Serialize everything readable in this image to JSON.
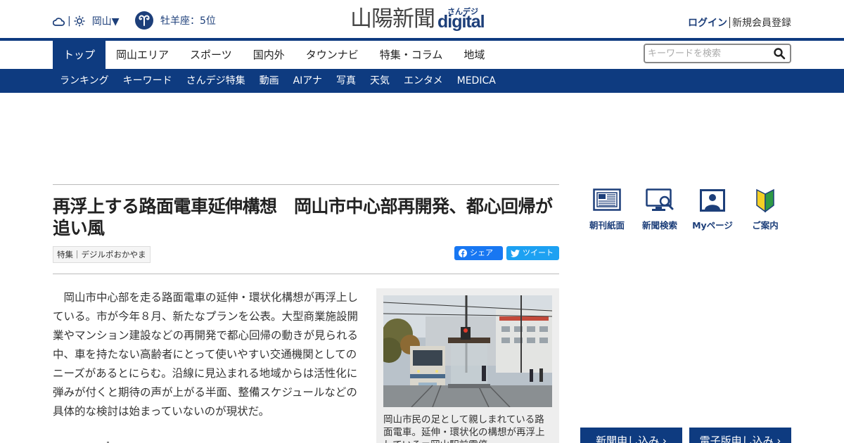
{
  "header": {
    "weather": {
      "region": "岡山▼"
    },
    "horoscope": {
      "text": "牡羊座：5位"
    },
    "logo": {
      "kanji": "山陽新聞",
      "small": "さんデジ",
      "digital": "digital"
    },
    "auth": {
      "login": "ログイン",
      "register": "新規会員登録"
    }
  },
  "nav": {
    "main": [
      "トップ",
      "岡山エリア",
      "スポーツ",
      "国内外",
      "タウンナビ",
      "特集・コラム",
      "地域"
    ],
    "active_index": 0,
    "search_placeholder": "キーワードを検索",
    "sub": [
      "ランキング",
      "キーワード",
      "さんデジ特集",
      "動画",
      "AIアナ",
      "写真",
      "天気",
      "エンタメ",
      "MEDICA"
    ]
  },
  "article": {
    "title": "再浮上する路面電車延伸構想　岡山市中心部再開発、都心回帰が追い風",
    "tag": "特集｜デジルポおかやま",
    "share_fb": "シェア",
    "share_tw": "ツイート",
    "body": "岡山市中心部を走る路面電車の延伸・環状化構想が再浮上している。市が今年８月、新たなプランを公表。大型商業施設開業やマンション建設などの再開発で都心回帰の動きが見られる中、車を持たない高齢者にとって使いやすい交通機関としてのニーズがあるとにらむ。沿線に見込まれる地域からは活性化に弾みが付くと期待の声が上がる半面、整備スケジュールなどの具体的な検討は始まっていないのが現状だ。",
    "caption": "岡山市民の足として親しまれている路面電車。延伸・環状化の構想が再浮上している＝岡山駅前電停"
  },
  "sidebar": {
    "quick_links": [
      "朝刊紙面",
      "新聞検索",
      "Myページ",
      "ご案内"
    ],
    "cta": [
      "新聞申し込み ›",
      "電子版申し込み ›"
    ]
  },
  "colors": {
    "brand": "#0e3b80",
    "facebook": "#1877f2",
    "twitter": "#1da1f2"
  }
}
